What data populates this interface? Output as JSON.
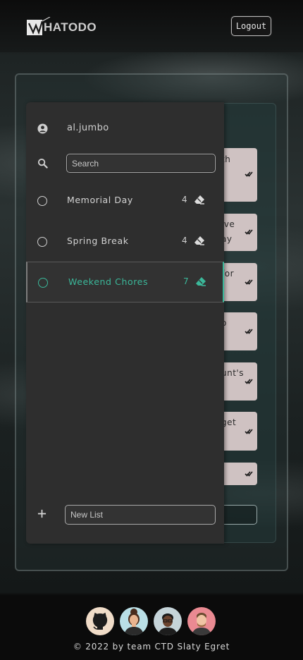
{
  "header": {
    "logo_text": "HATODO",
    "logout_label": "Logout"
  },
  "sidebar": {
    "username": "al.jumbo",
    "search_placeholder": "Search",
    "lists": [
      {
        "name": "Memorial Day",
        "count": "4"
      },
      {
        "name": "Spring Break",
        "count": "4"
      },
      {
        "name": "Weekend Chores",
        "count": "7",
        "active": true
      }
    ],
    "new_list_placeholder": "New List"
  },
  "tasks": [
    {
      "text": "th"
    },
    {
      "text": "ive\nay"
    },
    {
      "text": "for"
    },
    {
      "text": "o"
    },
    {
      "text": "unt's"
    },
    {
      "text": "get"
    },
    {
      "text": ""
    }
  ],
  "footer": {
    "copyright": "© 2022 by team CTD Slaty Egret",
    "avatars": [
      "github-icon",
      "team-member-1",
      "team-member-2",
      "team-member-3"
    ]
  },
  "colors": {
    "accent": "#3bb89a",
    "sidebar": "#2e2e2e",
    "task_card": "#cfc2c2"
  }
}
